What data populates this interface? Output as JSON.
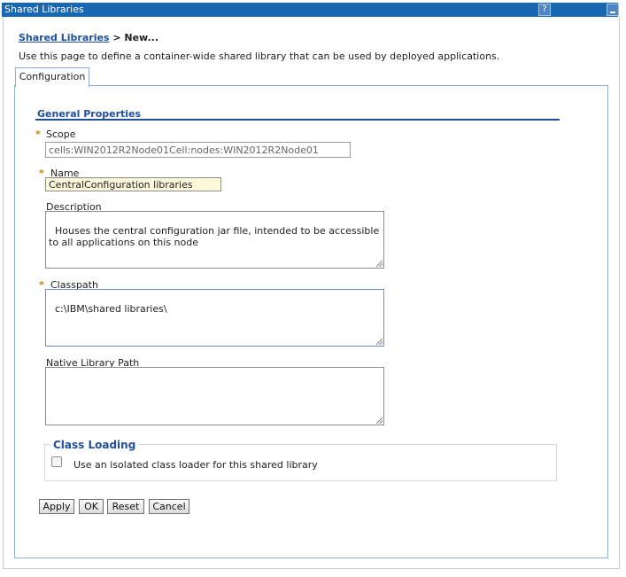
{
  "window": {
    "title": "Shared Libraries",
    "help_label": "?"
  },
  "breadcrumb": {
    "link": "Shared Libraries",
    "separator": " > ",
    "current": "New..."
  },
  "description": "Use this page to define a container-wide shared library that can be used by deployed applications.",
  "tabs": [
    {
      "label": "Configuration",
      "selected": true
    }
  ],
  "general_properties": {
    "title": "General Properties",
    "required_mark": "*",
    "scope": {
      "label": "Scope",
      "value": "cells:WIN2012R2Node01Cell:nodes:WIN2012R2Node01",
      "required": true
    },
    "name": {
      "label": "Name",
      "value": "CentralConfiguration libraries",
      "required": true
    },
    "description": {
      "label": "Description",
      "value": "Houses the central configuration jar file, intended to be accessible to all applications on this node"
    },
    "classpath": {
      "label": "Classpath",
      "value": "c:\\IBM\\shared libraries\\",
      "required": true
    },
    "native_library_path": {
      "label": "Native Library Path",
      "value": ""
    }
  },
  "class_loading": {
    "title": "Class Loading",
    "checkbox_label": "Use an isolated class loader for this shared library",
    "checked": false
  },
  "buttons": {
    "apply": "Apply",
    "ok": "OK",
    "reset": "Reset",
    "cancel": "Cancel"
  }
}
